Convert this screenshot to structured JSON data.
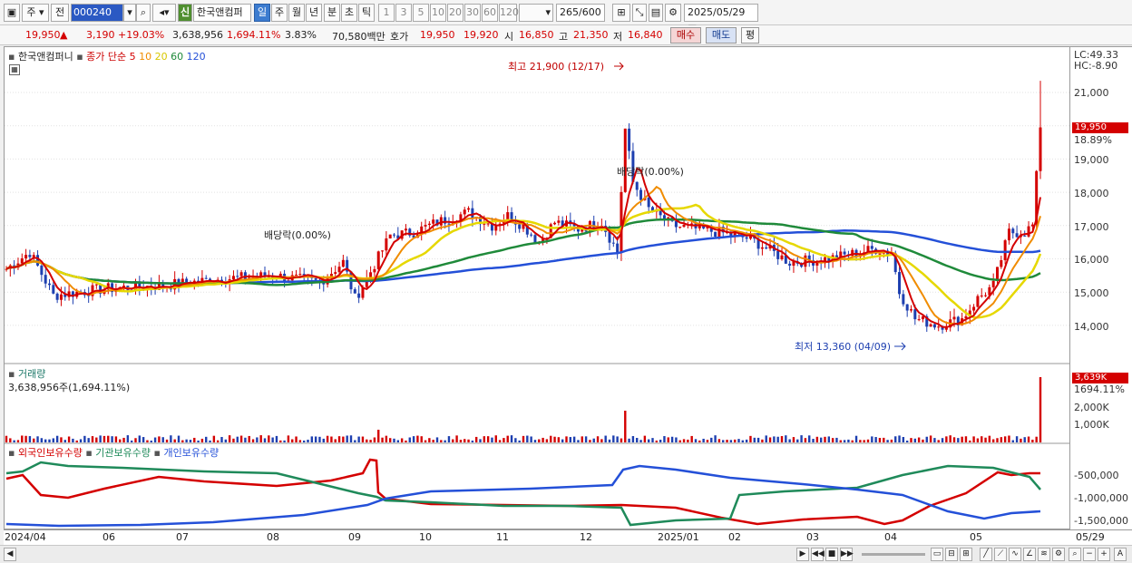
{
  "toolbar": {
    "period": "주",
    "prev": "전",
    "code": "000240",
    "name": "한국앤컴퍼",
    "new_badge": "신",
    "intervals": [
      "일",
      "주",
      "월",
      "년",
      "분",
      "초",
      "틱"
    ],
    "counts": [
      "1",
      "3",
      "5",
      "10",
      "20",
      "30",
      "60",
      "120"
    ],
    "bars_shown": "265",
    "bars_total": "/600",
    "date": "2025/05/29"
  },
  "quote": {
    "price": "19,950",
    "change": "3,190",
    "change_pct": "+19.03%",
    "volume": "3,638,956",
    "volume_pct": "1,694.11%",
    "turnover": "3.83%",
    "amount": "70,580백만",
    "bid_label": "호가",
    "ask": "19,950",
    "bid": "19,920",
    "open_label": "시",
    "open": "16,850",
    "high_label": "고",
    "high": "21,350",
    "low_label": "저",
    "low": "16,840",
    "buy": "매수",
    "sell": "매도",
    "eval": "평"
  },
  "price_panel": {
    "legend_name": "한국앤컴퍼니",
    "legend_type": "종가 단순",
    "ma_labels": [
      "5",
      "10",
      "20",
      "60",
      "120"
    ],
    "ma_colors": [
      "#d40000",
      "#f08c00",
      "#e6d800",
      "#1f8a3a",
      "#2450d8"
    ],
    "lc": "LC:49.33",
    "hc": "HC:-8.90",
    "current_tag": "19,950",
    "current_pct": "18.89%",
    "high_annotation": "최고 21,900 (12/17)",
    "low_annotation": "최저 13,360 (04/09)",
    "dividend_1": "배당락(0.00%)",
    "dividend_2": "배당락(0.00%)",
    "y_ticks": [
      "21,000",
      "20,000",
      "19,000",
      "18,000",
      "17,000",
      "16,000",
      "15,000",
      "14,000"
    ]
  },
  "volume_panel": {
    "title": "거래량",
    "value": "3,638,956주(1,694.11%)",
    "tag": "3,639K",
    "tag_pct": "1694.11%",
    "y_ticks": [
      "2,000K",
      "1,000K"
    ]
  },
  "holding_panel": {
    "series": [
      "외국인보유수량",
      "기관보유수량",
      "개인보유수량"
    ],
    "colors": [
      "#d40000",
      "#1f8a5a",
      "#2450d8"
    ],
    "y_ticks": [
      "-500,000",
      "-1,000,000",
      "-1,500,000"
    ]
  },
  "x_axis": [
    "2024/04",
    "06",
    "07",
    "08",
    "09",
    "10",
    "11",
    "12",
    "2025/01",
    "02",
    "03",
    "04",
    "05",
    "05/29"
  ],
  "colors": {
    "up": "#d40000",
    "down": "#1d3fb0",
    "accent": "#3c7cd0"
  }
}
